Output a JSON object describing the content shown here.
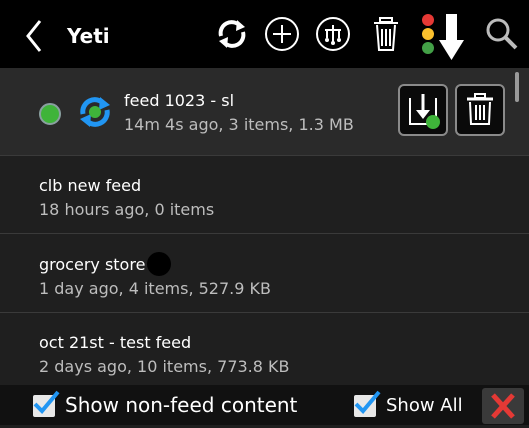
{
  "app": {
    "title": "Yeti"
  },
  "feeds": [
    {
      "name": "feed 1023 - sl",
      "meta": "14m 4s ago, 3 items, 1.3 MB"
    },
    {
      "name": "clb new feed",
      "meta": "18 hours ago, 0 items"
    },
    {
      "name": "grocery store",
      "meta": "1 day ago, 4 items, 527.9 KB"
    },
    {
      "name": "oct 21st - test feed",
      "meta": "2 days ago, 10 items, 773.8 KB"
    }
  ],
  "bottom": {
    "show_non_feed_label": "Show non-feed content",
    "show_all_label": "Show All"
  },
  "colors": {
    "accent_blue": "#2196f3",
    "status_green": "#3fb43a",
    "close_red": "#e53935"
  },
  "icons": [
    "back-icon",
    "sync-icon",
    "add-icon",
    "network-icon",
    "trash-icon",
    "traffic-light-download-icon",
    "search-icon",
    "download-icon",
    "checkbox-icon",
    "close-icon"
  ]
}
